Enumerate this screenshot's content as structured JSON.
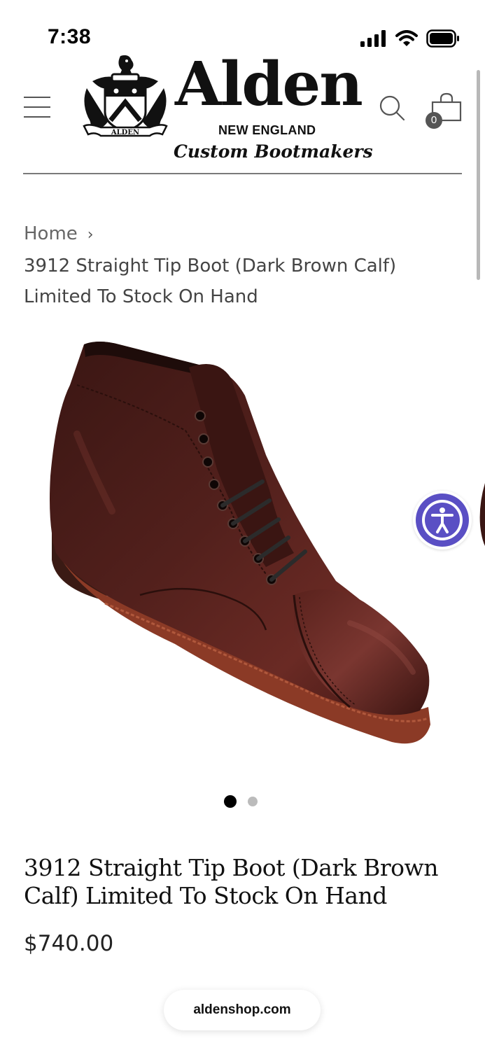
{
  "status_bar": {
    "time": "7:38"
  },
  "brand": {
    "wordmark": "Alden",
    "region": "NEW ENGLAND",
    "tagline": "Custom Bootmakers",
    "crest_ribbon": "ALDEN"
  },
  "header": {
    "cart_count": "0"
  },
  "breadcrumb": {
    "home": "Home",
    "separator": "›",
    "current": "3912 Straight Tip Boot (Dark Brown Calf) Limited To Stock On Hand"
  },
  "gallery": {
    "slide_count": 2,
    "active_index": 0
  },
  "product": {
    "title": "3912 Straight Tip Boot (Dark Brown Calf) Limited To Stock On Hand",
    "price": "$740.00"
  },
  "browser": {
    "url": "aldenshop.com"
  },
  "colors": {
    "accessibility_ring": "#5a4fc4",
    "leather": "#4a1c1a",
    "welt": "#8b3a26"
  },
  "icons": [
    "signal-icon",
    "wifi-icon",
    "battery-icon",
    "menu-icon",
    "search-icon",
    "bag-icon",
    "accessibility-icon"
  ]
}
